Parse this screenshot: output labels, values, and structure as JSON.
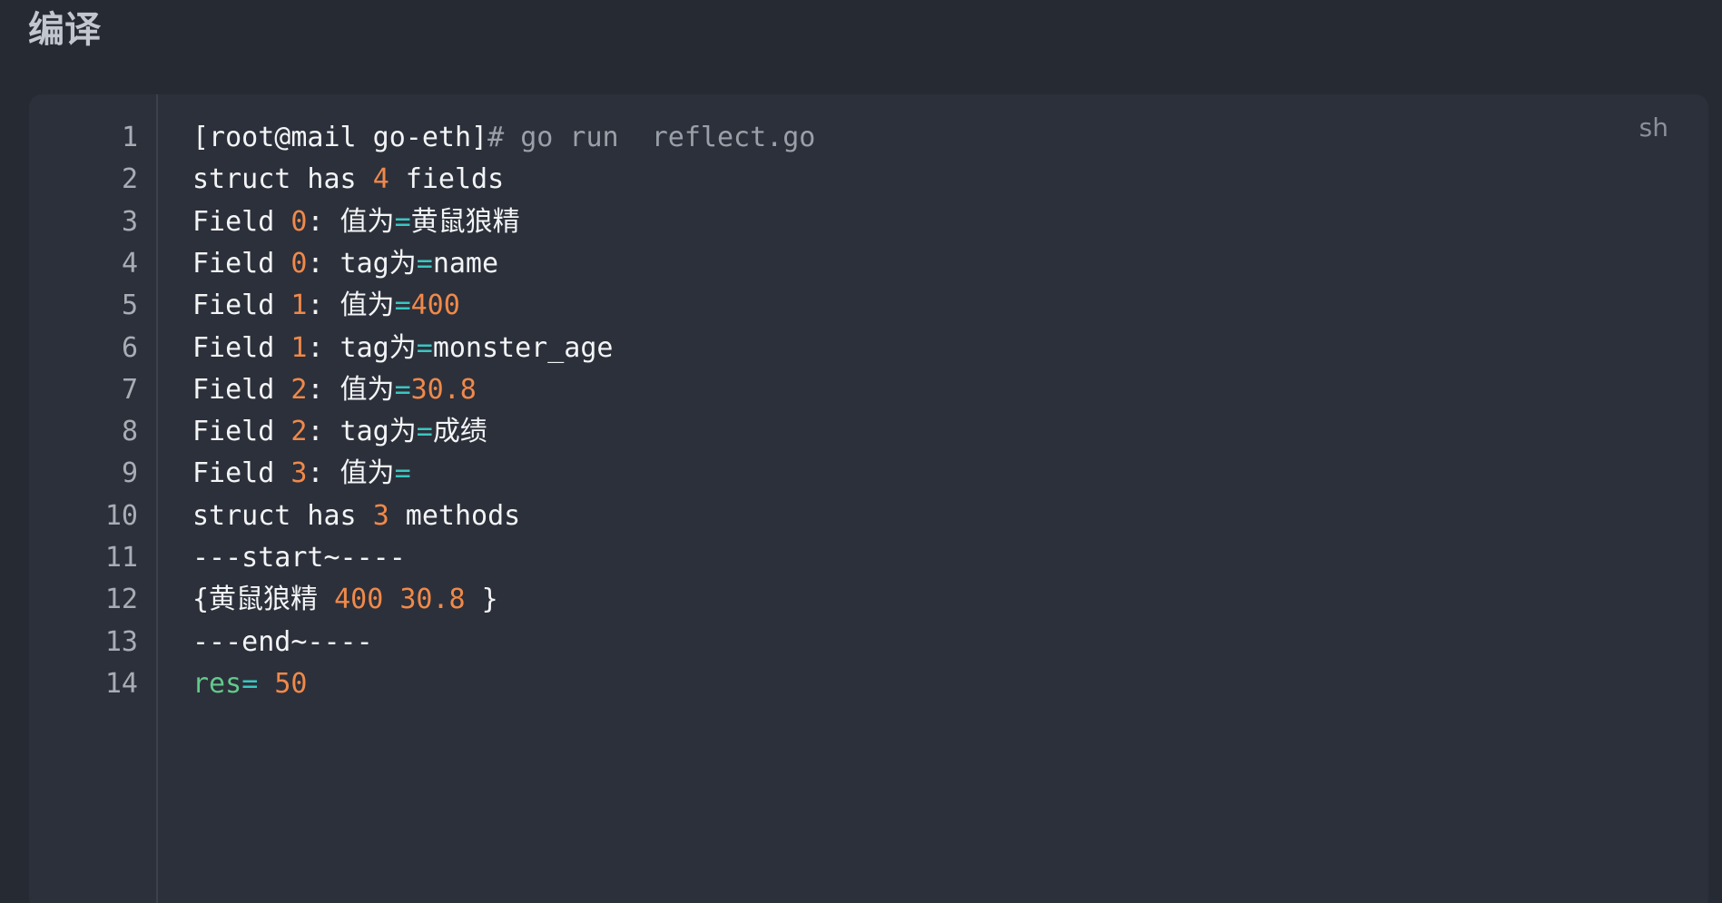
{
  "section": {
    "title": "编译"
  },
  "code_block": {
    "language": "sh",
    "line_numbers": [
      "1",
      "2",
      "3",
      "4",
      "5",
      "6",
      "7",
      "8",
      "9",
      "10",
      "11",
      "12",
      "13",
      "14"
    ],
    "lines": [
      [
        {
          "t": "[root@mail go-eth]",
          "c": "prompt"
        },
        {
          "t": "# go run  reflect.go",
          "c": "cmd"
        }
      ],
      [
        {
          "t": "struct has ",
          "c": "plain"
        },
        {
          "t": "4",
          "c": "num"
        },
        {
          "t": " fields",
          "c": "plain"
        }
      ],
      [
        {
          "t": "Field ",
          "c": "plain"
        },
        {
          "t": "0",
          "c": "num"
        },
        {
          "t": ": 值为",
          "c": "plain"
        },
        {
          "t": "=",
          "c": "op"
        },
        {
          "t": "黄鼠狼精",
          "c": "plain"
        }
      ],
      [
        {
          "t": "Field ",
          "c": "plain"
        },
        {
          "t": "0",
          "c": "num"
        },
        {
          "t": ": tag为",
          "c": "plain"
        },
        {
          "t": "=",
          "c": "op"
        },
        {
          "t": "name",
          "c": "plain"
        }
      ],
      [
        {
          "t": "Field ",
          "c": "plain"
        },
        {
          "t": "1",
          "c": "num"
        },
        {
          "t": ": 值为",
          "c": "plain"
        },
        {
          "t": "=",
          "c": "op"
        },
        {
          "t": "400",
          "c": "num"
        }
      ],
      [
        {
          "t": "Field ",
          "c": "plain"
        },
        {
          "t": "1",
          "c": "num"
        },
        {
          "t": ": tag为",
          "c": "plain"
        },
        {
          "t": "=",
          "c": "op"
        },
        {
          "t": "monster_age",
          "c": "plain"
        }
      ],
      [
        {
          "t": "Field ",
          "c": "plain"
        },
        {
          "t": "2",
          "c": "num"
        },
        {
          "t": ": 值为",
          "c": "plain"
        },
        {
          "t": "=",
          "c": "op"
        },
        {
          "t": "30.8",
          "c": "num"
        }
      ],
      [
        {
          "t": "Field ",
          "c": "plain"
        },
        {
          "t": "2",
          "c": "num"
        },
        {
          "t": ": tag为",
          "c": "plain"
        },
        {
          "t": "=",
          "c": "op"
        },
        {
          "t": "成绩",
          "c": "plain"
        }
      ],
      [
        {
          "t": "Field ",
          "c": "plain"
        },
        {
          "t": "3",
          "c": "num"
        },
        {
          "t": ": 值为",
          "c": "plain"
        },
        {
          "t": "=",
          "c": "op"
        }
      ],
      [
        {
          "t": "struct has ",
          "c": "plain"
        },
        {
          "t": "3",
          "c": "num"
        },
        {
          "t": " methods",
          "c": "plain"
        }
      ],
      [
        {
          "t": "---start~----",
          "c": "plain"
        }
      ],
      [
        {
          "t": "{黄鼠狼精 ",
          "c": "plain"
        },
        {
          "t": "400",
          "c": "num"
        },
        {
          "t": " ",
          "c": "plain"
        },
        {
          "t": "30.8",
          "c": "num"
        },
        {
          "t": " }",
          "c": "plain"
        }
      ],
      [
        {
          "t": "---end~----",
          "c": "plain"
        }
      ],
      [
        {
          "t": "res",
          "c": "var"
        },
        {
          "t": "=",
          "c": "op"
        },
        {
          "t": " ",
          "c": "plain"
        },
        {
          "t": "50",
          "c": "num"
        }
      ]
    ]
  },
  "colors": {
    "background": "#262a33",
    "code_background": "#2c303a",
    "number": "#f0894a",
    "operator": "#38c7c2",
    "variable": "#62c98c",
    "text": "#f3f4f6"
  }
}
